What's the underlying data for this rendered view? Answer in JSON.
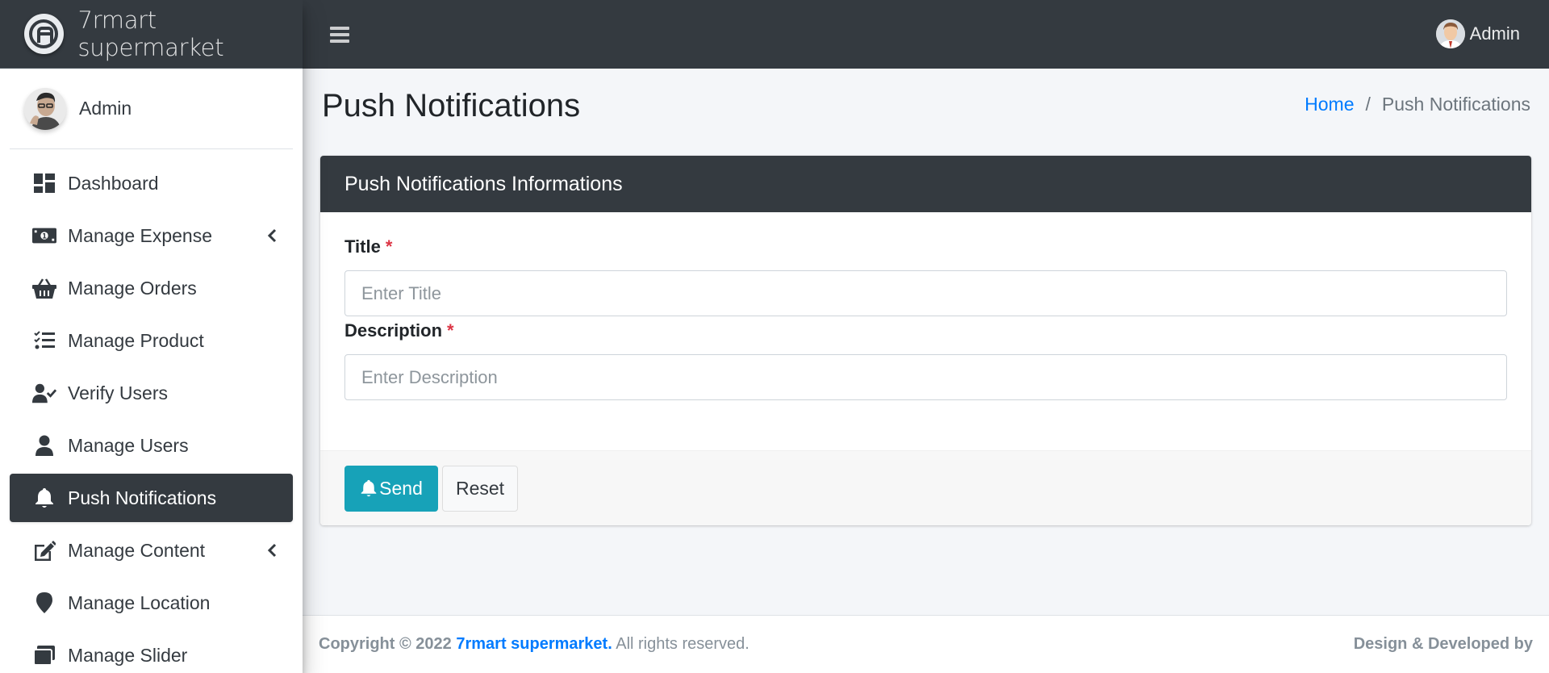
{
  "brand": {
    "name": "7rmart supermarket"
  },
  "sidebar": {
    "user_name": "Admin",
    "items": [
      {
        "label": "Dashboard",
        "icon": "dashboard-icon",
        "has_chevron": false,
        "active": false
      },
      {
        "label": "Manage Expense",
        "icon": "money-bill-icon",
        "has_chevron": true,
        "active": false
      },
      {
        "label": "Manage Orders",
        "icon": "basket-icon",
        "has_chevron": false,
        "active": false
      },
      {
        "label": "Manage Product",
        "icon": "tasks-list-icon",
        "has_chevron": false,
        "active": false
      },
      {
        "label": "Verify Users",
        "icon": "user-check-icon",
        "has_chevron": false,
        "active": false
      },
      {
        "label": "Manage Users",
        "icon": "user-icon",
        "has_chevron": false,
        "active": false
      },
      {
        "label": "Push Notifications",
        "icon": "bell-icon",
        "has_chevron": false,
        "active": true
      },
      {
        "label": "Manage Content",
        "icon": "edit-icon",
        "has_chevron": true,
        "active": false
      },
      {
        "label": "Manage Location",
        "icon": "map-marker-icon",
        "has_chevron": false,
        "active": false
      },
      {
        "label": "Manage Slider",
        "icon": "slider-icon",
        "has_chevron": false,
        "active": false
      }
    ]
  },
  "header": {
    "user_name": "Admin"
  },
  "page": {
    "title": "Push Notifications",
    "breadcrumb": {
      "home": "Home",
      "separator": "/",
      "current": "Push Notifications"
    }
  },
  "form": {
    "card_title": "Push Notifications Informations",
    "title_label": "Title",
    "title_placeholder": "Enter Title",
    "title_value": "",
    "description_label": "Description",
    "description_placeholder": "Enter Description",
    "description_value": "",
    "required_marker": "*",
    "send_label": "Send",
    "reset_label": "Reset"
  },
  "footer": {
    "copyright_prefix": "Copyright © 2022",
    "brand_link": "7rmart supermarket.",
    "rights": "All rights reserved.",
    "credit": "Design & Developed by"
  },
  "colors": {
    "dark": "#343a40",
    "primary": "#007bff",
    "info": "#17a2b8",
    "danger": "#dc3545"
  }
}
